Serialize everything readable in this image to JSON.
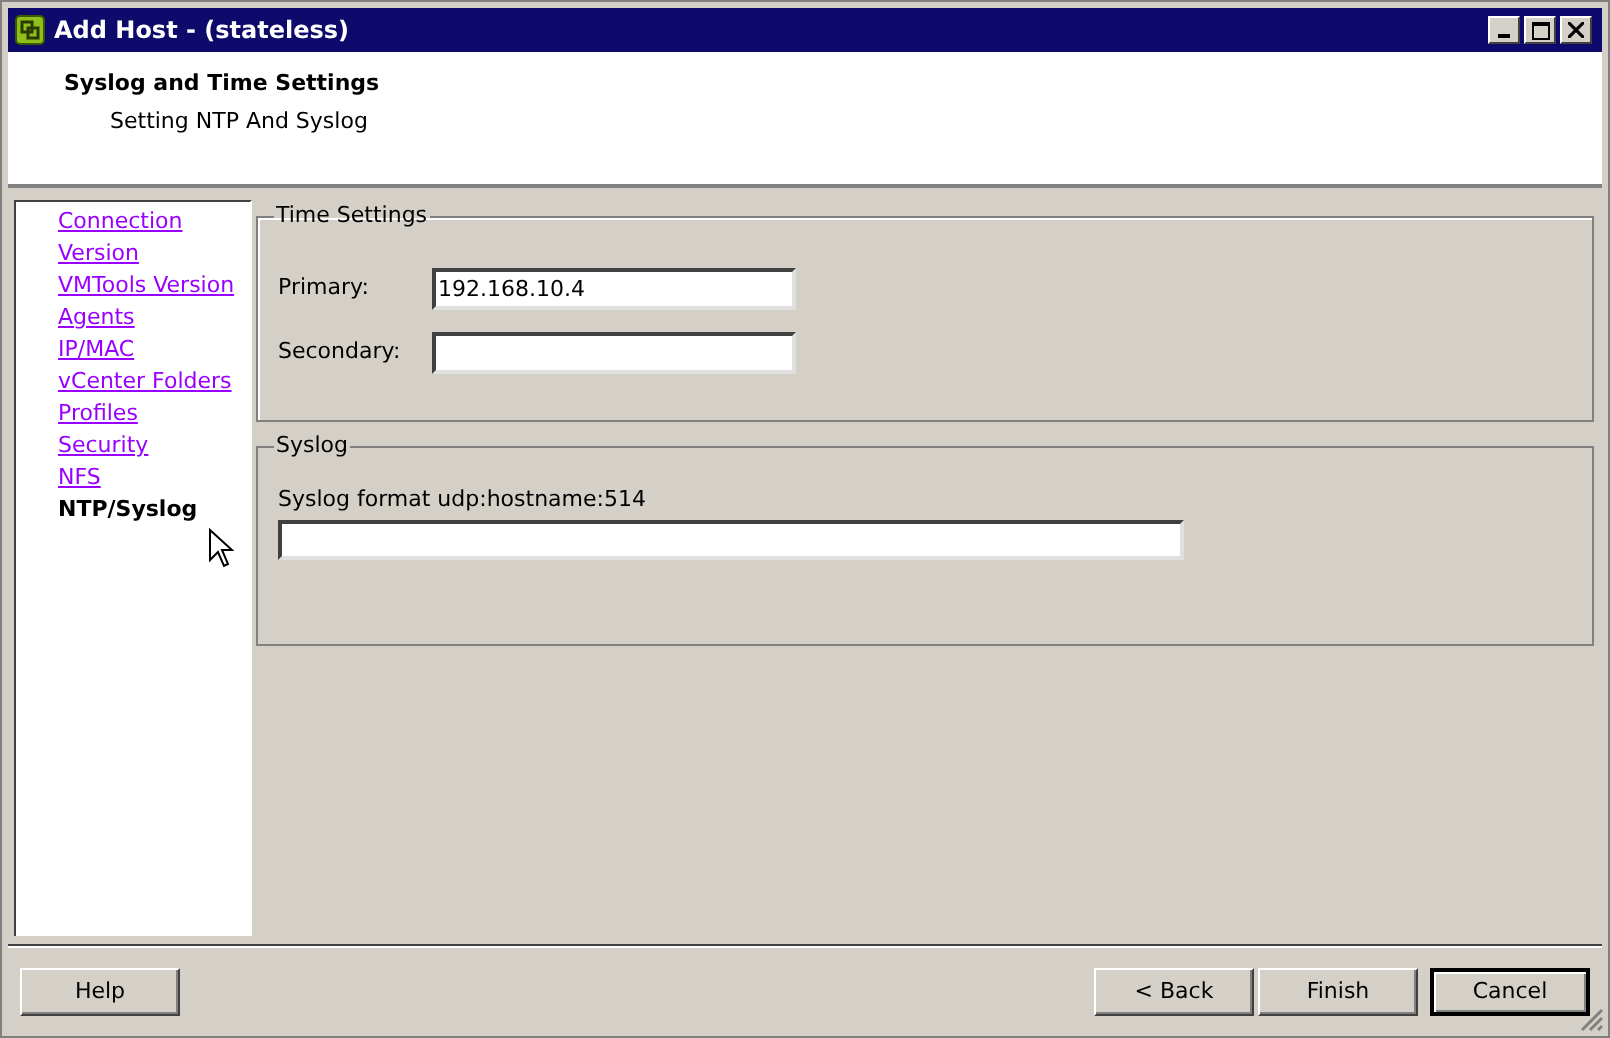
{
  "window": {
    "title": "Add Host - (stateless)"
  },
  "header": {
    "title": "Syslog and Time Settings",
    "subtitle": "Setting NTP And Syslog"
  },
  "sidebar": {
    "items": [
      {
        "label": "Connection",
        "selected": false
      },
      {
        "label": "Version",
        "selected": false
      },
      {
        "label": "VMTools Version",
        "selected": false
      },
      {
        "label": "Agents",
        "selected": false
      },
      {
        "label": "IP/MAC",
        "selected": false
      },
      {
        "label": "vCenter Folders",
        "selected": false
      },
      {
        "label": "Profiles",
        "selected": false
      },
      {
        "label": "Security",
        "selected": false
      },
      {
        "label": "NFS",
        "selected": false
      },
      {
        "label": "NTP/Syslog",
        "selected": true
      }
    ]
  },
  "time_settings": {
    "legend": "Time Settings",
    "fields": [
      {
        "label": "Primary:",
        "value": "192.168.10.4"
      },
      {
        "label": "Secondary:"
      }
    ]
  },
  "syslog": {
    "legend": "Syslog",
    "label": "Syslog format udp:hostname:514"
  },
  "buttons": [
    {
      "label": "Help",
      "kind": "left",
      "default": false
    },
    {
      "label": "< Back",
      "kind": "right",
      "default": false
    },
    {
      "label": "Finish",
      "kind": "right",
      "default": false
    },
    {
      "label": "Cancel",
      "kind": "right",
      "default": true
    }
  ]
}
